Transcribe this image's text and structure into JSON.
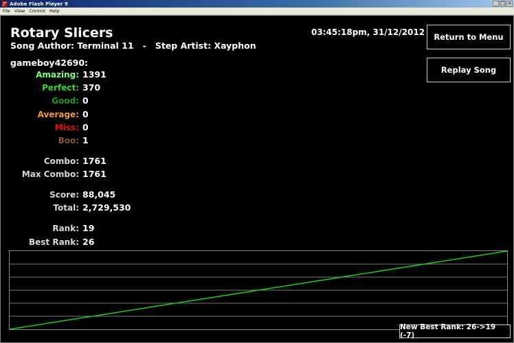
{
  "window": {
    "title": "Adobe Flash Player 9",
    "menu": [
      "File",
      "View",
      "Control",
      "Help"
    ]
  },
  "song": {
    "title": "Rotary Slicers",
    "credits": "Song Author: Terminal 11   -   Step Artist: Xayphon",
    "timestamp": "03:45:18pm, 31/12/2012"
  },
  "buttons": {
    "return_menu": "Return to Menu",
    "replay": "Replay Song"
  },
  "player": {
    "name": "gameboy42690:"
  },
  "judgements": [
    {
      "label": "Amazing:",
      "value": "1391",
      "color": "#7cff7c"
    },
    {
      "label": "Perfect:",
      "value": "370",
      "color": "#2fd82f"
    },
    {
      "label": "Good:",
      "value": "0",
      "color": "#1a9a1a"
    },
    {
      "label": "Average:",
      "value": "0",
      "color": "#f09a40"
    },
    {
      "label": "Miss:",
      "value": "0",
      "color": "#e01010"
    },
    {
      "label": "Boo:",
      "value": "1",
      "color": "#8a5630"
    }
  ],
  "combo": {
    "combo_label": "Combo:",
    "combo_value": "1761",
    "max_label": "Max Combo:",
    "max_value": "1761"
  },
  "score": {
    "score_label": "Score:",
    "score_value": "88,045",
    "total_label": "Total:",
    "total_value": "2,729,530"
  },
  "rank": {
    "rank_label": "Rank:",
    "rank_value": "19",
    "best_label": "Best Rank:",
    "best_value": "26"
  },
  "notice": {
    "new_best": "New Best Rank: 26->19 (-7)"
  },
  "colors": {
    "graph_line": "#22cc22",
    "grid_line": "#7a7a7a"
  }
}
